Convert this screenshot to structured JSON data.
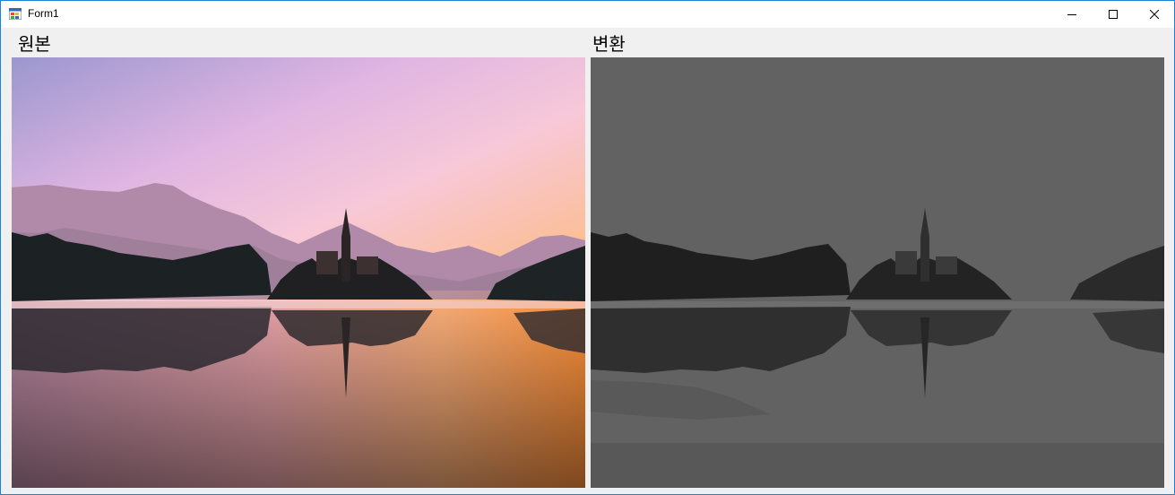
{
  "window": {
    "title": "Form1",
    "icon": "app-form-icon"
  },
  "controls": {
    "minimize_icon": "minimize-icon",
    "maximize_icon": "maximize-icon",
    "close_icon": "close-icon"
  },
  "labels": {
    "original": "원본",
    "converted": "변환"
  },
  "images": {
    "original": {
      "content": "lake-bled-island-church-sunrise",
      "style": "color"
    },
    "converted": {
      "content": "lake-bled-island-church-sunrise",
      "style": "grayscale-darkened"
    }
  },
  "colors": {
    "border": "#1883d7",
    "client_bg": "#f0f0f0",
    "gray_panel": "#626262"
  }
}
